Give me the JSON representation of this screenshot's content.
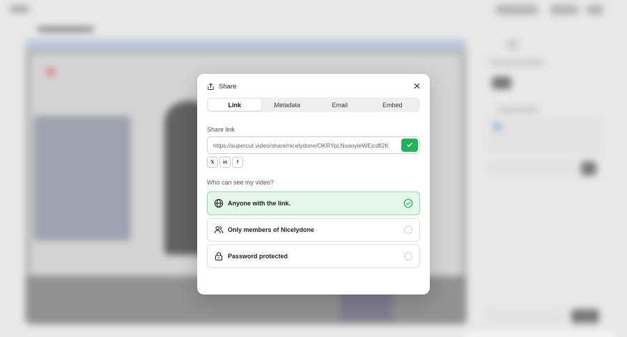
{
  "dialog": {
    "title": "Share",
    "tabs": [
      {
        "label": "Link",
        "active": true
      },
      {
        "label": "Metadata",
        "active": false
      },
      {
        "label": "Email",
        "active": false
      },
      {
        "label": "Embed",
        "active": false
      }
    ],
    "share_link_label": "Share link",
    "share_link_value": "https://supercut.video/share/nicelydone/OKRYpLNxaoyleWEjcdll2K",
    "social_buttons": [
      "𝕏",
      "in",
      "f"
    ],
    "visibility_label": "Who can see my video?",
    "options": [
      {
        "label": "Anyone with the link.",
        "icon": "globe-icon",
        "selected": true
      },
      {
        "label": "Only members of Nicelydone",
        "icon": "users-icon",
        "selected": false
      },
      {
        "label": "Password protected",
        "icon": "lock-icon",
        "selected": false
      }
    ]
  },
  "colors": {
    "accent_green": "#1fb45b",
    "selected_bg": "#e4f7e9",
    "selected_border": "#8fd9a6"
  }
}
